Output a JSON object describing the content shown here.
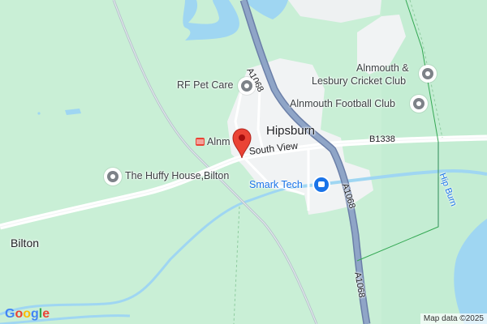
{
  "map": {
    "places": {
      "hipsburn": "Hipsburn",
      "bilton": "Bilton",
      "alnmouth_station": "Alnm",
      "huffy_house": "The Huffy House,Bilton",
      "rf_pet_care": "RF Pet Care",
      "cricket_club_line1": "Alnmouth &",
      "cricket_club_line2": "Lesbury Cricket Club",
      "football_club": "Alnmouth Football Club",
      "smark_tech": "Smark Tech"
    },
    "roads": {
      "south_view": "South View",
      "b1338": "B1338",
      "a1068_north": "A1068",
      "a1068_mid": "A1068",
      "a1068_south": "A1068"
    },
    "water": {
      "hip_burn": "Hip Burn"
    },
    "icons": {
      "poi": "place-icon",
      "business": "shop-icon",
      "station": "train-icon",
      "marker": "location-pin-icon"
    },
    "colors": {
      "land": "#c9efd6",
      "urban": "#f1f3f4",
      "water": "#9fd6f2",
      "highway": "#8fa5c7",
      "marker": "#ea4335"
    }
  },
  "google_logo": {
    "G": "G",
    "o1": "o",
    "o2": "o",
    "g": "g",
    "l": "l",
    "e": "e"
  },
  "attribution": "Map data ©2025"
}
